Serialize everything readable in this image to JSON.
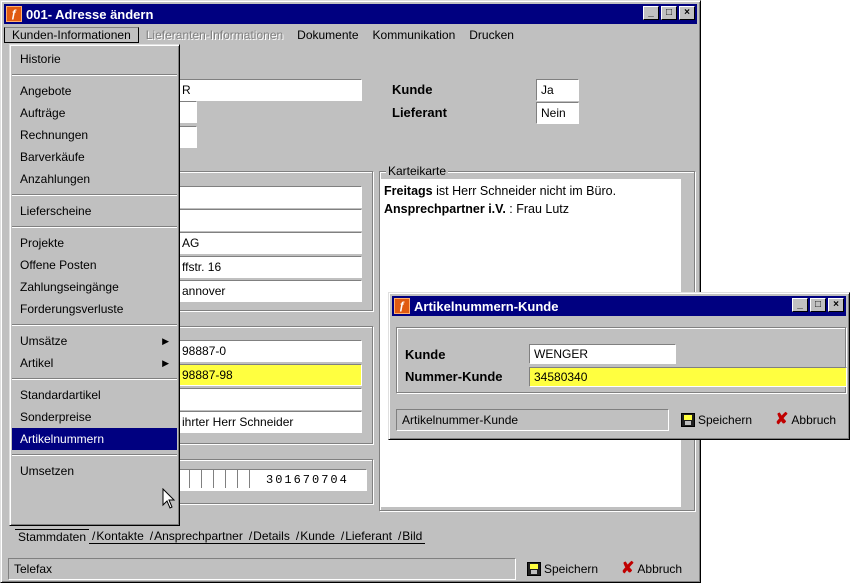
{
  "main_window": {
    "title": "001- Adresse ändern",
    "menu": [
      {
        "label": "Kunden-Informationen",
        "state": "active"
      },
      {
        "label": "Lieferanten-Informationen",
        "state": "disabled"
      },
      {
        "label": "Dokumente",
        "state": "normal"
      },
      {
        "label": "Kommunikation",
        "state": "normal"
      },
      {
        "label": "Drucken",
        "state": "normal"
      }
    ]
  },
  "header_fields": {
    "name_partial": "R",
    "kunde_label": "Kunde",
    "kunde_value": "Ja",
    "lieferant_label": "Lieferant",
    "lieferant_value": "Nein"
  },
  "address": {
    "line3": "AG",
    "line4": "ffstr. 16",
    "line5": "annover"
  },
  "contact": {
    "phone": "98887-0",
    "fax": "98887-98",
    "note": "ihrter Herr Schneider"
  },
  "barcode": {
    "value": "301670704"
  },
  "karteikarte": {
    "title": "Karteikarte",
    "line1_bold": "Freitags",
    "line1_rest": " ist Herr Schneider nicht im Büro.",
    "line2_bold": "Ansprechpartner i.V.",
    "line2_rest": " : Frau Lutz"
  },
  "dropdown": {
    "items": [
      {
        "label": "Historie",
        "type": "item"
      },
      {
        "type": "sep"
      },
      {
        "label": "Angebote",
        "type": "item"
      },
      {
        "label": "Aufträge",
        "type": "item"
      },
      {
        "label": "Rechnungen",
        "type": "item"
      },
      {
        "label": "Barverkäufe",
        "type": "item"
      },
      {
        "label": "Anzahlungen",
        "type": "item"
      },
      {
        "type": "sep"
      },
      {
        "label": "Lieferscheine",
        "type": "item"
      },
      {
        "type": "sep"
      },
      {
        "label": "Projekte",
        "type": "item"
      },
      {
        "label": "Offene Posten",
        "type": "item"
      },
      {
        "label": "Zahlungseingänge",
        "type": "item"
      },
      {
        "label": "Forderungsverluste",
        "type": "item"
      },
      {
        "type": "sep"
      },
      {
        "label": "Umsätze",
        "type": "submenu"
      },
      {
        "label": "Artikel",
        "type": "submenu"
      },
      {
        "type": "sep"
      },
      {
        "label": "Standardartikel",
        "type": "item"
      },
      {
        "label": "Sonderpreise",
        "type": "item"
      },
      {
        "label": "Artikelnummern",
        "type": "item",
        "selected": true
      },
      {
        "type": "sep"
      },
      {
        "label": "Umsetzen",
        "type": "item"
      }
    ]
  },
  "tabs": [
    "Stammdaten",
    "Kontakte",
    "Ansprechpartner",
    "Details",
    "Kunde",
    "Lieferant",
    "Bild"
  ],
  "status_main": {
    "text": "Telefax",
    "save_label": "Speichern",
    "cancel_label": "Abbruch"
  },
  "dialog": {
    "title": "Artikelnummern-Kunde",
    "kunde_label": "Kunde",
    "kunde_value": "WENGER",
    "nummer_label": "Nummer-Kunde",
    "nummer_value": "34580340",
    "status_text": "Artikelnummer-Kunde",
    "save_label": "Speichern",
    "cancel_label": "Abbruch"
  },
  "icons": {
    "app": "app-logo-icon",
    "minimize": "minimize-icon",
    "maximize": "maximize-icon",
    "close": "close-icon",
    "save": "floppy-disk-icon",
    "cancel": "red-x-icon",
    "cursor": "mouse-pointer-icon"
  }
}
